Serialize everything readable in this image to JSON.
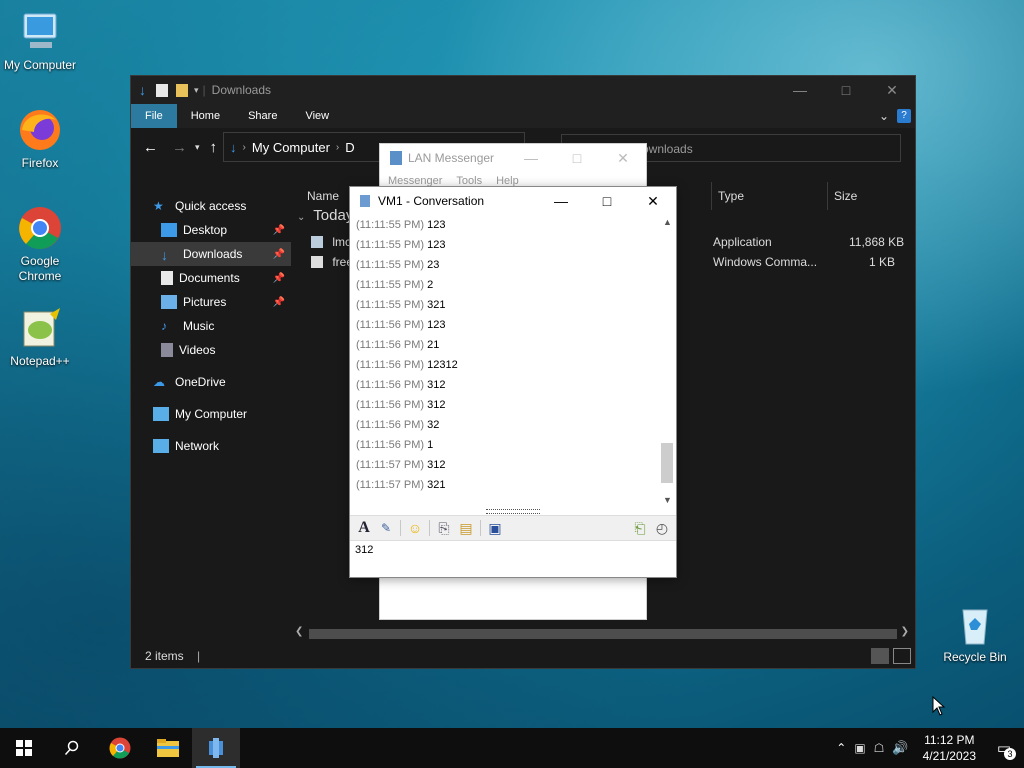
{
  "desktop": {
    "icons": [
      {
        "label": "My Computer"
      },
      {
        "label": "Firefox"
      },
      {
        "label": "Google Chrome"
      },
      {
        "label": "Notepad++"
      },
      {
        "label": "Recycle Bin"
      }
    ]
  },
  "explorer": {
    "title": "Downloads",
    "ribbon_tabs": [
      "File",
      "Home",
      "Share",
      "View"
    ],
    "address": {
      "root": "My Computer",
      "next": "D"
    },
    "search_placeholder": "ownloads",
    "nav": [
      {
        "label": "Quick access",
        "pinned": false
      },
      {
        "label": "Desktop",
        "pinned": true
      },
      {
        "label": "Downloads",
        "pinned": true
      },
      {
        "label": "Documents",
        "pinned": true
      },
      {
        "label": "Pictures",
        "pinned": true
      },
      {
        "label": "Music",
        "pinned": false
      },
      {
        "label": "Videos",
        "pinned": false
      },
      {
        "label": "OneDrive",
        "pinned": false
      },
      {
        "label": "My Computer",
        "pinned": false
      },
      {
        "label": "Network",
        "pinned": false
      }
    ],
    "columns": {
      "name": "Name",
      "type": "Type",
      "size": "Size"
    },
    "group": "Today",
    "files": [
      {
        "name": "lmc",
        "type": "Application",
        "size": "11,868 KB"
      },
      {
        "name": "free",
        "type": "Windows Comma...",
        "size": "1 KB"
      }
    ],
    "status": "2 items"
  },
  "lan_main": {
    "title": "LAN Messenger",
    "menu": [
      "Messenger",
      "Tools",
      "Help"
    ]
  },
  "conversation": {
    "title": "VM1 - Conversation",
    "messages": [
      {
        "time": "(11:11:55 PM)",
        "text": "123"
      },
      {
        "time": "(11:11:55 PM)",
        "text": "123"
      },
      {
        "time": "(11:11:55 PM)",
        "text": "23"
      },
      {
        "time": "(11:11:55 PM)",
        "text": "2"
      },
      {
        "time": "(11:11:55 PM)",
        "text": "321"
      },
      {
        "time": "(11:11:56 PM)",
        "text": "123"
      },
      {
        "time": "(11:11:56 PM)",
        "text": "21"
      },
      {
        "time": "(11:11:56 PM)",
        "text": "12312"
      },
      {
        "time": "(11:11:56 PM)",
        "text": "312"
      },
      {
        "time": "(11:11:56 PM)",
        "text": "312"
      },
      {
        "time": "(11:11:56 PM)",
        "text": "32"
      },
      {
        "time": "(11:11:56 PM)",
        "text": "1"
      },
      {
        "time": "(11:11:57 PM)",
        "text": "312"
      },
      {
        "time": "(11:11:57 PM)",
        "text": "321"
      }
    ],
    "input_value": "312"
  },
  "taskbar": {
    "time": "11:12 PM",
    "date": "4/21/2023",
    "notification_count": "3"
  }
}
